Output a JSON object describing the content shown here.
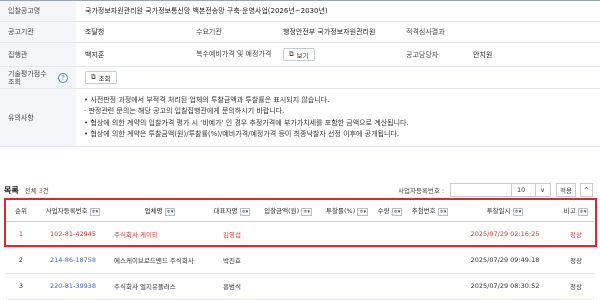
{
  "info": {
    "rows": [
      {
        "label": "입찰공고명",
        "value": "국가정보자원관리원 국가정보통신망 백본전송망 구축·운영사업(2026년~2030년)"
      },
      {
        "label": "공고기관",
        "value": "조달청",
        "label2": "수요기관",
        "value2": "행정안전부 국가정보자원관리원",
        "label3": "적격심사결과",
        "value3": ""
      },
      {
        "label": "집행관",
        "value": "백지훈",
        "label2": "복수예비가격 및 예정가격",
        "button2": "보기",
        "label3": "공고담당자",
        "value3": "안치원"
      },
      {
        "label": "기술평가점수 조회",
        "button": "조회"
      }
    ],
    "notes_label": "유의사항",
    "notes": [
      "• 사전판정 과정에서 부적격 처리된 업체의 투찰금액과 투찰률은 표시되지 않습니다.",
      "  · 판정관련 문의는 해당 공고의 입찰집행관에게 문의하시기 바랍니다.",
      "• 협상에 의한 계약의 입찰가격 평가 시 '비예가' 인 경우 추정가격에 부가가치세를 포함한 금액으로 계산됩니다.",
      "• 협상에 의한 계약은 투찰금액(원)/투찰률(%)/예비가격/예정가격 등이 최종낙찰자 선정 이후에 공개됩니다."
    ]
  },
  "list": {
    "title": "목록",
    "count_prefix": "전체",
    "count": "3",
    "count_suffix": "건",
    "biz_label": "사업자등록번호 :",
    "page_size": "10",
    "apply_label": "적용",
    "up_icon": "^"
  },
  "table": {
    "columns": [
      "순위",
      "사업자등록번호",
      "업체명",
      "대표자명",
      "입찰금액(원)",
      "투찰률(%)",
      "수량",
      "추첨번호",
      "투찰일시",
      "비고"
    ],
    "sorter_label": "≑▾",
    "rows": [
      {
        "rank": "1",
        "biz_no": "102-81-42945",
        "company": "주식회사 케이티",
        "ceo": "김영섭",
        "amount": "",
        "rate": "",
        "qty": "",
        "draw": "",
        "date": "2025/07/29 02:16:25",
        "note": "정상"
      },
      {
        "rank": "2",
        "biz_no": "214-86-18758",
        "company": "에스케이브로드밴드 주식회사",
        "ceo": "박진효",
        "amount": "",
        "rate": "",
        "qty": "",
        "draw": "",
        "date": "2025/07/29 09:49:18",
        "note": "정상"
      },
      {
        "rank": "3",
        "biz_no": "220-81-39938",
        "company": "주식회사 엘지유플러스",
        "ceo": "홍범식",
        "amount": "",
        "rate": "",
        "qty": "",
        "draw": "",
        "date": "2025/07/29 08:30:52",
        "note": "정상"
      }
    ]
  },
  "colors": {
    "highlight": "#e0262b",
    "link": "#3b64c2",
    "count": "#d33333"
  }
}
